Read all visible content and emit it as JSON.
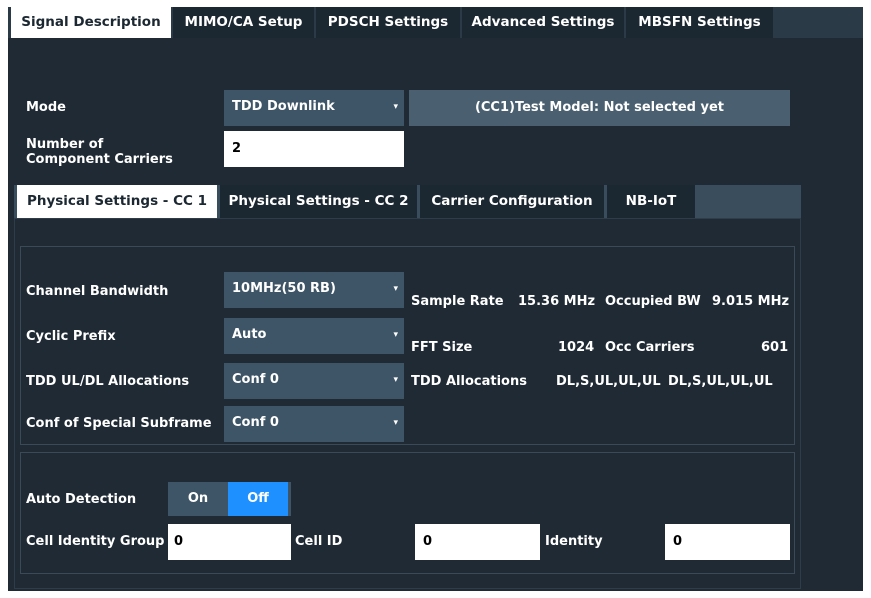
{
  "main_tabs": [
    {
      "label": "Signal Description"
    },
    {
      "label": "MIMO/CA Setup"
    },
    {
      "label": "PDSCH Settings"
    },
    {
      "label": "Advanced Settings"
    },
    {
      "label": "MBSFN Settings"
    }
  ],
  "mode": {
    "label": "Mode",
    "value": "TDD Downlink",
    "info": "(CC1)Test Model: Not selected yet"
  },
  "component_carriers": {
    "label": "Number of\nComponent Carriers",
    "value": "2"
  },
  "sub_tabs": [
    {
      "label": "Physical Settings - CC 1"
    },
    {
      "label": "Physical Settings - CC 2"
    },
    {
      "label": "Carrier Configuration"
    },
    {
      "label": "NB-IoT"
    }
  ],
  "physical": {
    "channel_bandwidth": {
      "label": "Channel Bandwidth",
      "value": "10MHz(50 RB)"
    },
    "cyclic_prefix": {
      "label": "Cyclic Prefix",
      "value": "Auto"
    },
    "tdd_alloc": {
      "label": "TDD UL/DL Allocations",
      "value": "Conf 0"
    },
    "special_subframe": {
      "label": "Conf of Special Subframe",
      "value": "Conf 0"
    },
    "sample_rate": {
      "label": "Sample Rate",
      "value": "15.36 MHz"
    },
    "occupied_bw": {
      "label": "Occupied BW",
      "value": "9.015 MHz"
    },
    "fft_size": {
      "label": "FFT Size",
      "value": "1024"
    },
    "occ_carriers": {
      "label": "Occ Carriers",
      "value": "601"
    },
    "tdd_allocations": {
      "label": "TDD Allocations",
      "value1": "DL,S,UL,UL,UL",
      "value2": "DL,S,UL,UL,UL"
    }
  },
  "cell": {
    "auto_detection": {
      "label": "Auto Detection",
      "on": "On",
      "off": "Off",
      "selected": "Off"
    },
    "cell_identity_group": {
      "label": "Cell Identity Group",
      "value": "0"
    },
    "cell_id": {
      "label": "Cell ID",
      "value": "0"
    },
    "identity": {
      "label": "Identity",
      "value": "0"
    }
  },
  "icons": {
    "dropdown": "chevron-down-icon"
  },
  "colors": {
    "accent": "#1e90ff",
    "background": "#1f2a34",
    "control": "#3e5567"
  }
}
